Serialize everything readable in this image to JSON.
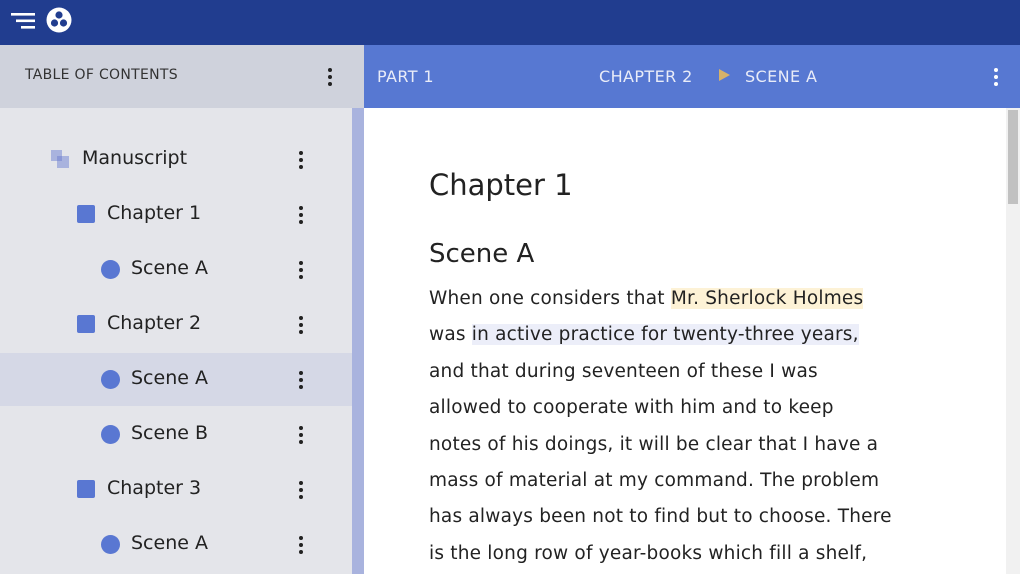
{
  "topbar": {
    "menu_icon": "menu-lines-icon",
    "logo_icon": "three-dots-circle-logo-icon",
    "colors": {
      "background": "#213d8f"
    }
  },
  "toc": {
    "title": "TABLE OF CONTENTS",
    "items": [
      {
        "label": "Manuscript",
        "icon": "manuscript-icon",
        "level": 0,
        "selected": false
      },
      {
        "label": "Chapter 1",
        "icon": "chapter-square-icon",
        "level": 1,
        "selected": false
      },
      {
        "label": "Scene A",
        "icon": "scene-dot-icon",
        "level": 2,
        "selected": false
      },
      {
        "label": "Chapter 2",
        "icon": "chapter-square-icon",
        "level": 1,
        "selected": false
      },
      {
        "label": "Scene A",
        "icon": "scene-dot-icon",
        "level": 2,
        "selected": true
      },
      {
        "label": "Scene B",
        "icon": "scene-dot-icon",
        "level": 2,
        "selected": false
      },
      {
        "label": "Chapter 3",
        "icon": "chapter-square-icon",
        "level": 1,
        "selected": false
      },
      {
        "label": "Scene A",
        "icon": "scene-dot-icon",
        "level": 2,
        "selected": false
      }
    ],
    "colors": {
      "panel": "#e4e5ea",
      "header": "#cfd2dc",
      "selected": "#d5d8e6",
      "icon": "#5977d2"
    }
  },
  "content_header": {
    "part": "PART 1",
    "breadcrumb": [
      "CHAPTER 2",
      "SCENE A"
    ],
    "colors": {
      "background": "#5778d2",
      "arrow": "#d6b26a"
    }
  },
  "document": {
    "chapter_title": "Chapter 1",
    "scene_title": "Scene A",
    "lines": [
      [
        {
          "text": "When one considers that "
        },
        {
          "text": "Mr. Sherlock Holmes",
          "hl": "yellow"
        }
      ],
      [
        {
          "text": "was "
        },
        {
          "text": "in active practice for twenty-three years,",
          "hl": "blue"
        }
      ],
      [
        {
          "text": "and that during seventeen of these I was"
        }
      ],
      [
        {
          "text": "allowed to cooperate with him and to keep"
        }
      ],
      [
        {
          "text": "notes of his doings, it will be clear that I have a"
        }
      ],
      [
        {
          "text": "mass of material at my command. The problem"
        }
      ],
      [
        {
          "text": "has always been not to find but to choose. There"
        }
      ],
      [
        {
          "text": "is the long row of year-books which fill a shelf,"
        }
      ]
    ],
    "colors": {
      "highlight_yellow": "#fdf2d6",
      "highlight_blue": "#eceef9"
    }
  }
}
